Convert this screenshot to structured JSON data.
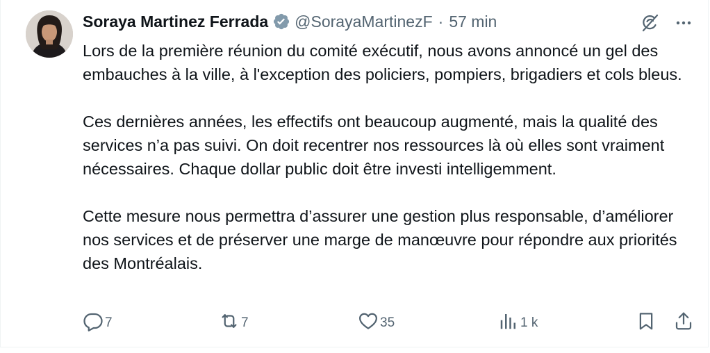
{
  "tweet": {
    "author_name": "Soraya Martinez Ferrada",
    "handle": "@SorayaMartinezF",
    "separator": "·",
    "time": "57 min",
    "paragraphs": [
      "Lors de la première réunion du comité exécutif, nous avons annoncé un gel des embauches à la ville, à l'exception des policiers, pompiers, brigadiers et cols bleus.",
      "Ces dernières années, les effectifs ont beaucoup augmenté, mais la qualité des services n’a pas suivi. On doit recentrer nos ressources là où elles sont vraiment nécessaires. Chaque dollar public doit être investi intelligemment.",
      "Cette mesure nous permettra d’assurer une gestion plus responsable, d’améliorer nos services et de préserver une marge de manœuvre pour répondre aux priorités des Montréalais."
    ]
  },
  "actions": {
    "replies": "7",
    "reposts": "7",
    "likes": "35",
    "views": "1 k"
  },
  "icons": {
    "verified": "verified-badge-icon",
    "grok": "grok-icon",
    "more": "more-icon",
    "reply": "reply-icon",
    "repost": "repost-icon",
    "like": "heart-icon",
    "views": "views-icon",
    "bookmark": "bookmark-icon",
    "share": "share-icon"
  },
  "colors": {
    "text": "#0f1419",
    "secondary": "#536471",
    "verified_badge": "#829aab"
  }
}
